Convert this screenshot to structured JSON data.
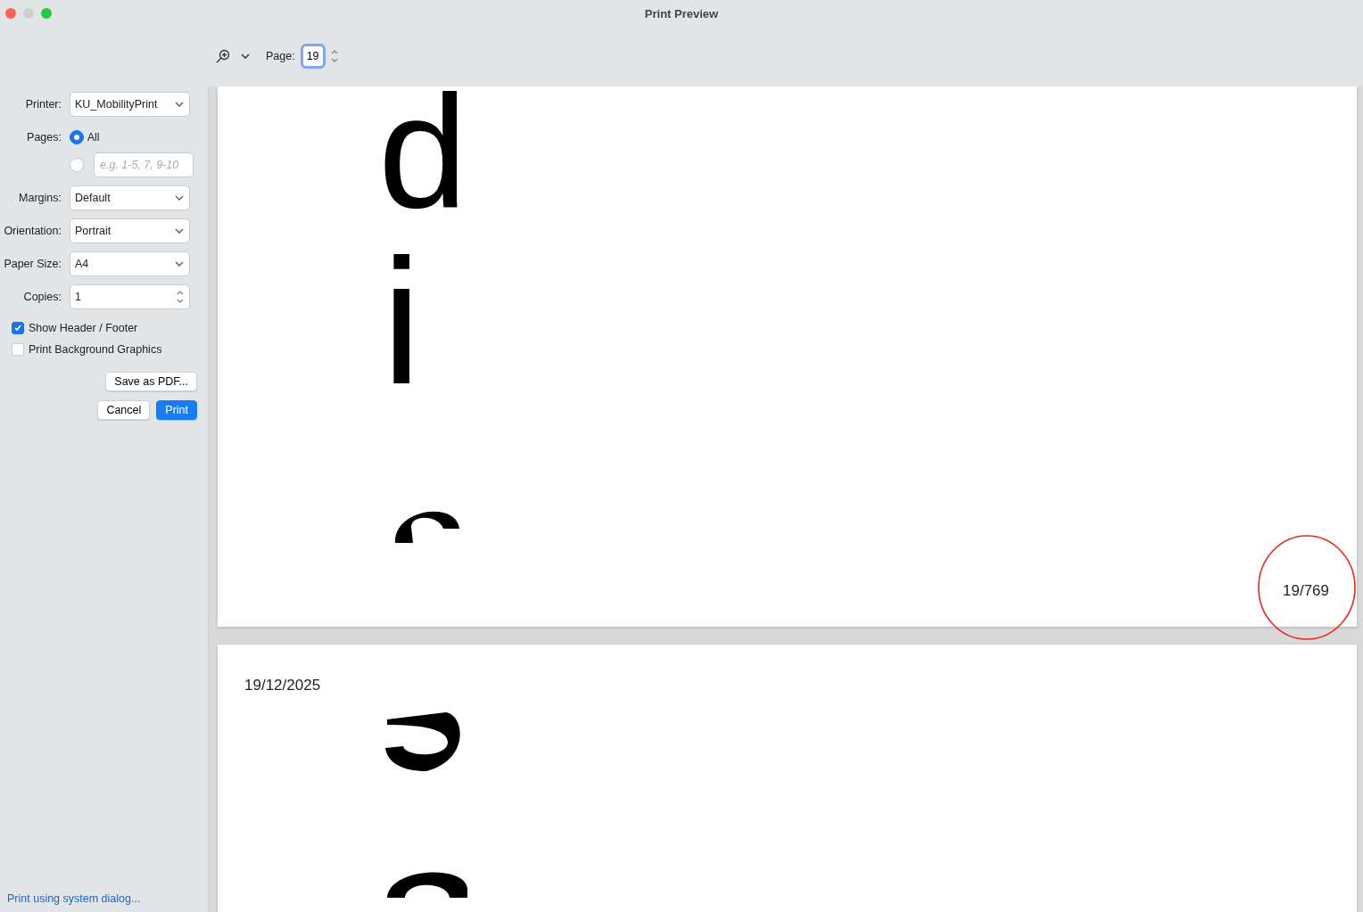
{
  "window": {
    "title": "Print Preview"
  },
  "toolbar": {
    "page_label": "Page:",
    "page_value": "19"
  },
  "settings": {
    "rows": [
      {
        "kind": "select",
        "label": "Printer:",
        "value": "KU_MobilityPrint"
      },
      {
        "kind": "radio",
        "label": "Pages:",
        "value": "All",
        "selected": true
      },
      {
        "kind": "radio_field",
        "placeholder": "e.g. 1-5, 7, 9-10",
        "selected": false
      },
      {
        "kind": "select",
        "label": "Margins:",
        "value": "Default"
      },
      {
        "kind": "select",
        "label": "Orientation:",
        "value": "Portrait"
      },
      {
        "kind": "select",
        "label": "Paper Size:",
        "value": "A4"
      },
      {
        "kind": "stepper",
        "label": "Copies:",
        "value": "1"
      }
    ],
    "checkboxes": [
      {
        "label": "Show Header / Footer",
        "checked": true
      },
      {
        "label": "Print Background Graphics",
        "checked": false
      }
    ],
    "save_button": "Save as PDF...",
    "cancel_button": "Cancel",
    "print_button": "Print",
    "system_dialog_link": "Print using system dialog..."
  },
  "preview": {
    "pages": [
      {
        "letters": [
          "d",
          "i"
        ],
        "footer": "19/769"
      },
      {
        "header": "19/12/2025"
      }
    ]
  }
}
